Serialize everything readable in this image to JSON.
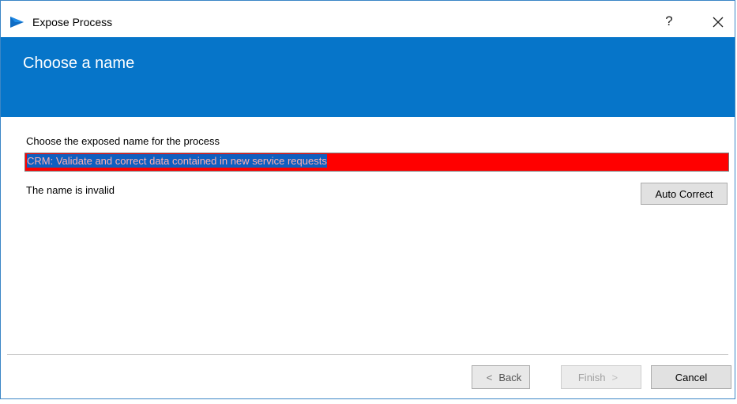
{
  "window": {
    "title": "Expose Process",
    "help_label": "?",
    "logo_icon": "blueprism-logo-icon",
    "close_icon": "close-icon"
  },
  "banner": {
    "title": "Choose a name",
    "color": "#0675c9"
  },
  "form": {
    "label": "Choose the exposed name for the process",
    "input_value": "CRM: Validate and correct data contained in new service requests",
    "input_state": "invalid",
    "input_bg_color": "#ff0000",
    "status_text": "The name is invalid",
    "auto_correct_label": "Auto Correct"
  },
  "footer": {
    "back_label": "Back",
    "back_arrow": "<",
    "finish_label": "Finish",
    "finish_arrow": ">",
    "cancel_label": "Cancel"
  }
}
